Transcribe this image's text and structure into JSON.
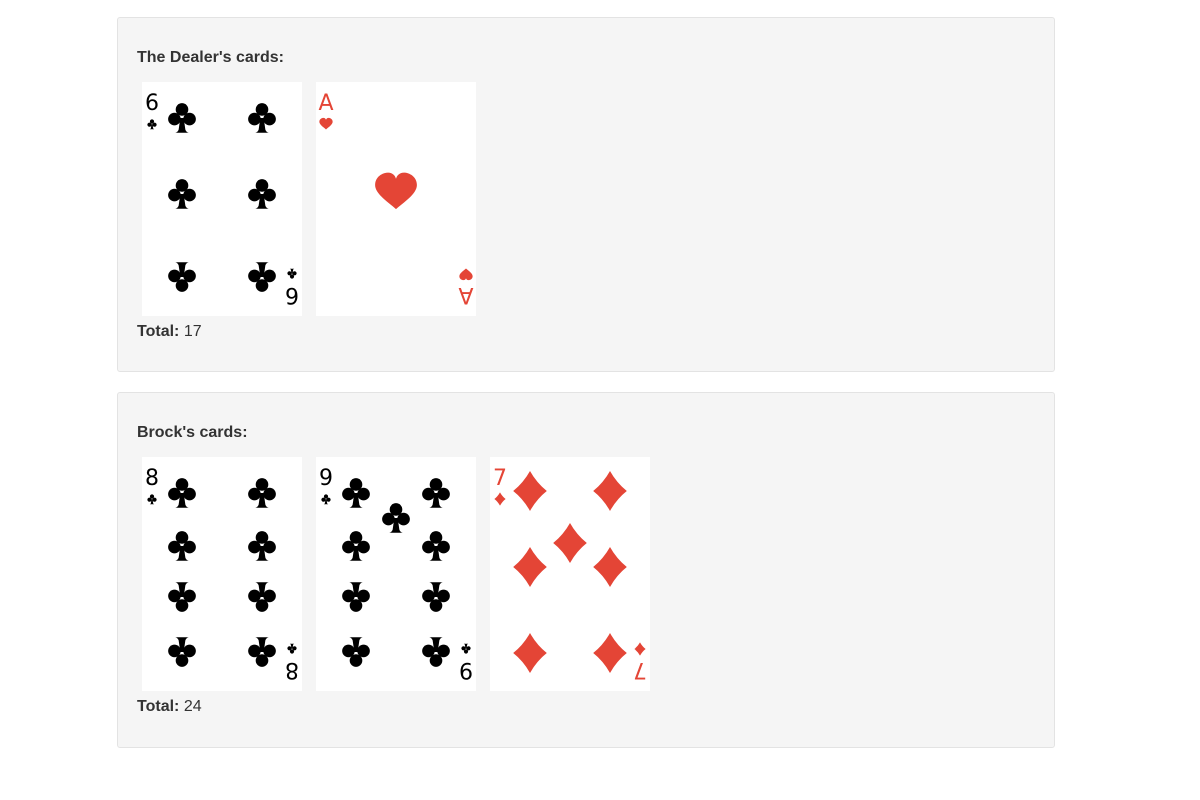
{
  "colors": {
    "black_suit": "#000000",
    "red_suit": "#e44536",
    "panel_bg": "#f5f5f5",
    "panel_border": "#e3e3e3"
  },
  "dealer": {
    "title": "The Dealer's cards:",
    "total_label": "Total:",
    "total_value": "17",
    "cards": [
      {
        "rank": "6",
        "suit": "clubs",
        "suit_icon": "club-icon"
      },
      {
        "rank": "A",
        "suit": "hearts",
        "suit_icon": "heart-icon"
      }
    ]
  },
  "player": {
    "title": "Brock's cards:",
    "total_label": "Total:",
    "total_value": "24",
    "cards": [
      {
        "rank": "8",
        "suit": "clubs",
        "suit_icon": "club-icon"
      },
      {
        "rank": "9",
        "suit": "clubs",
        "suit_icon": "club-icon"
      },
      {
        "rank": "7",
        "suit": "diamonds",
        "suit_icon": "diamond-icon"
      }
    ]
  }
}
